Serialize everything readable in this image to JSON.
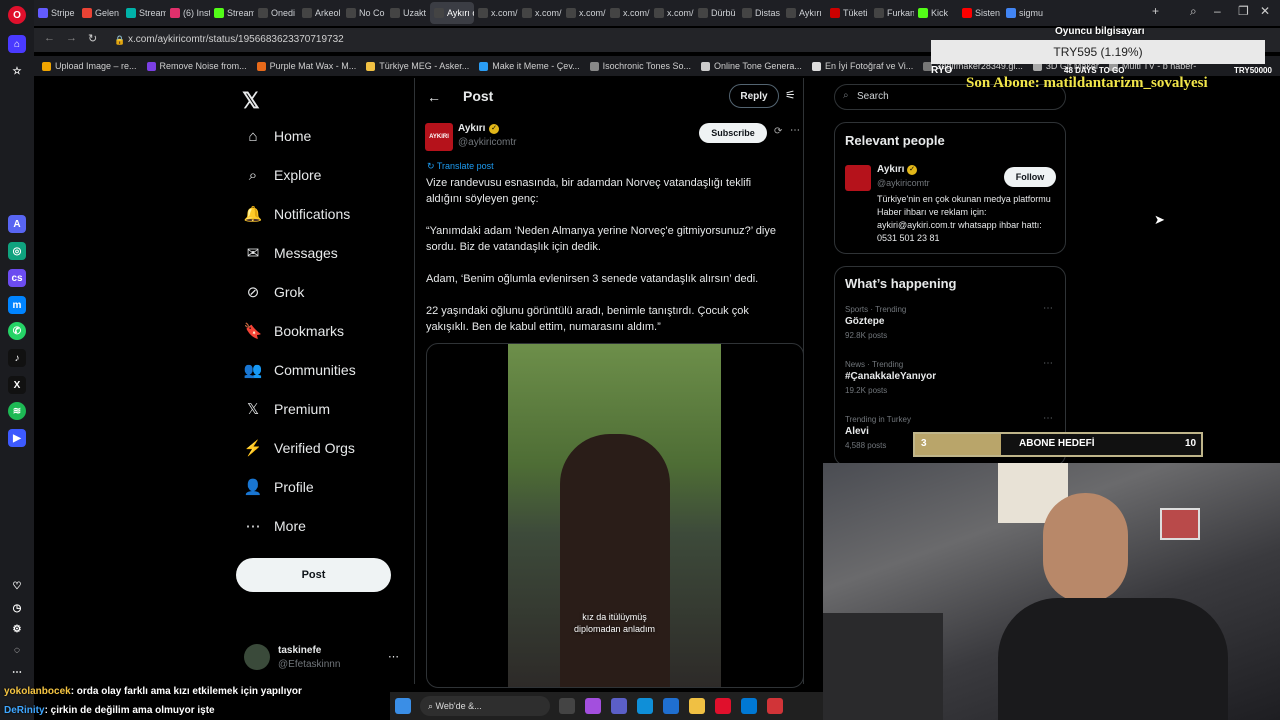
{
  "browser": {
    "tabs": [
      {
        "label": "Stripe",
        "color": "#635bff"
      },
      {
        "label": "Gelen",
        "color": "#ea4335"
      },
      {
        "label": "Stream",
        "color": "#00b2a9"
      },
      {
        "label": "(6) Inst",
        "color": "#e1306c"
      },
      {
        "label": "Stream",
        "color": "#53fc18"
      },
      {
        "label": "Onedi",
        "color": "#444"
      },
      {
        "label": "Arkeol",
        "color": "#444"
      },
      {
        "label": "No Co",
        "color": "#444"
      },
      {
        "label": "Uzakt",
        "color": "#444"
      },
      {
        "label": "Aykırı on X",
        "color": "#444"
      },
      {
        "label": "x.com/",
        "color": "#444"
      },
      {
        "label": "x.com/",
        "color": "#444"
      },
      {
        "label": "x.com/",
        "color": "#444"
      },
      {
        "label": "x.com/",
        "color": "#444"
      },
      {
        "label": "x.com/",
        "color": "#444"
      },
      {
        "label": "Dürbü",
        "color": "#444"
      },
      {
        "label": "Distas",
        "color": "#444"
      },
      {
        "label": "Aykırı",
        "color": "#444"
      },
      {
        "label": "Tüketi",
        "color": "#c00"
      },
      {
        "label": "Furkan",
        "color": "#444"
      },
      {
        "label": "Kick",
        "color": "#53fc18"
      },
      {
        "label": "Sisten",
        "color": "#ff0000"
      },
      {
        "label": "sigmu",
        "color": "#4285f4"
      }
    ],
    "url": "x.com/aykiricomtr/status/1956683623370719732",
    "bookmarks": [
      "Upload Image – re...",
      "Remove Noise from...",
      "Purple Mat Wax - M...",
      "Türkiye MEG - Asker...",
      "Make it Meme - Çev...",
      "Isochronic Tones So...",
      "Online Tone Genera...",
      "En İyi Fotoğraf ve Vi...",
      "3dgifmaker28349.gi...",
      "3D Gif Maker",
      "Multi TV - b haber-"
    ]
  },
  "nav": {
    "items": [
      "Home",
      "Explore",
      "Notifications",
      "Messages",
      "Grok",
      "Bookmarks",
      "Communities",
      "Premium",
      "Verified Orgs",
      "Profile",
      "More"
    ],
    "post_label": "Post",
    "account_name": "taskinefe",
    "account_handle": "@Efetaskinnn"
  },
  "post": {
    "header_title": "Post",
    "reply_label": "Reply",
    "author_name": "Aykırı",
    "author_handle": "@aykiricomtr",
    "avatar_text": "AYKIRI",
    "subscribe_label": "Subscribe",
    "translate_label": "Translate post",
    "paragraphs": [
      "Vize randevusu esnasında, bir adamdan Norveç vatandaşlığı teklifi aldığını söyleyen genç:",
      "“Yanımdaki adam ‘Neden Almanya yerine Norveç'e gitmiyorsunuz?’ diye sordu. Biz de vatandaşlık için dedik.",
      "Adam, ‘Benim oğlumla evlenirsen 3 senede vatandaşlık alırsın’ dedi.",
      "22 yaşındaki oğlunu görüntülü aradı, benimle tanıştırdı. Çocuk çok yakışıklı. Ben de kabul ettim, numarasını aldım.”"
    ],
    "video_caption_1": "kız da itülüymüş",
    "video_caption_2": "diplomadan anladım"
  },
  "sidebar": {
    "search_placeholder": "Search",
    "relevant_title": "Relevant people",
    "rp_name": "Aykırı",
    "rp_handle": "@aykiricomtr",
    "rp_follow": "Follow",
    "rp_bio": "Türkiye'nin en çok okunan medya platformu Haber ihbarı ve reklam için: aykiri@aykiri.com.tr whatsapp ihbar hattı: 0531 501 23 81",
    "happening_title": "What’s happening",
    "trends": [
      {
        "context": "Sports · Trending",
        "name": "Göztepe",
        "posts": "92.8K posts"
      },
      {
        "context": "News · Trending",
        "name": "#ÇanakkaleYanıyor",
        "posts": "19.2K posts"
      },
      {
        "context": "Trending in Turkey",
        "name": "Alevi",
        "posts": "4,588 posts"
      }
    ]
  },
  "overlay": {
    "donation_title": "Oyuncu bilgisayarı",
    "donation_amount": "TRY595 (1.19%)",
    "donation_left": "RYO",
    "donation_days": "48 DAYS TO GO",
    "donation_target": "TRY50000",
    "last_sub": "Son Abone: matildantarizm_sovalyesi",
    "goal_current": "3",
    "goal_label": "ABONE HEDEFİ",
    "goal_target": "10",
    "goal_fraction": 0.3
  },
  "chat": [
    {
      "user": "yokolanbocek",
      "msg": ": orda olay farklı ama kızı etkilemek için yapılıyor",
      "color": "#f5c542"
    },
    {
      "user": "DeRinity",
      "msg": ": çirkin de değilim ama olmuyor işte",
      "color": "#3fa7ff"
    }
  ],
  "taskbar": {
    "search_label": "Web'de &..."
  }
}
